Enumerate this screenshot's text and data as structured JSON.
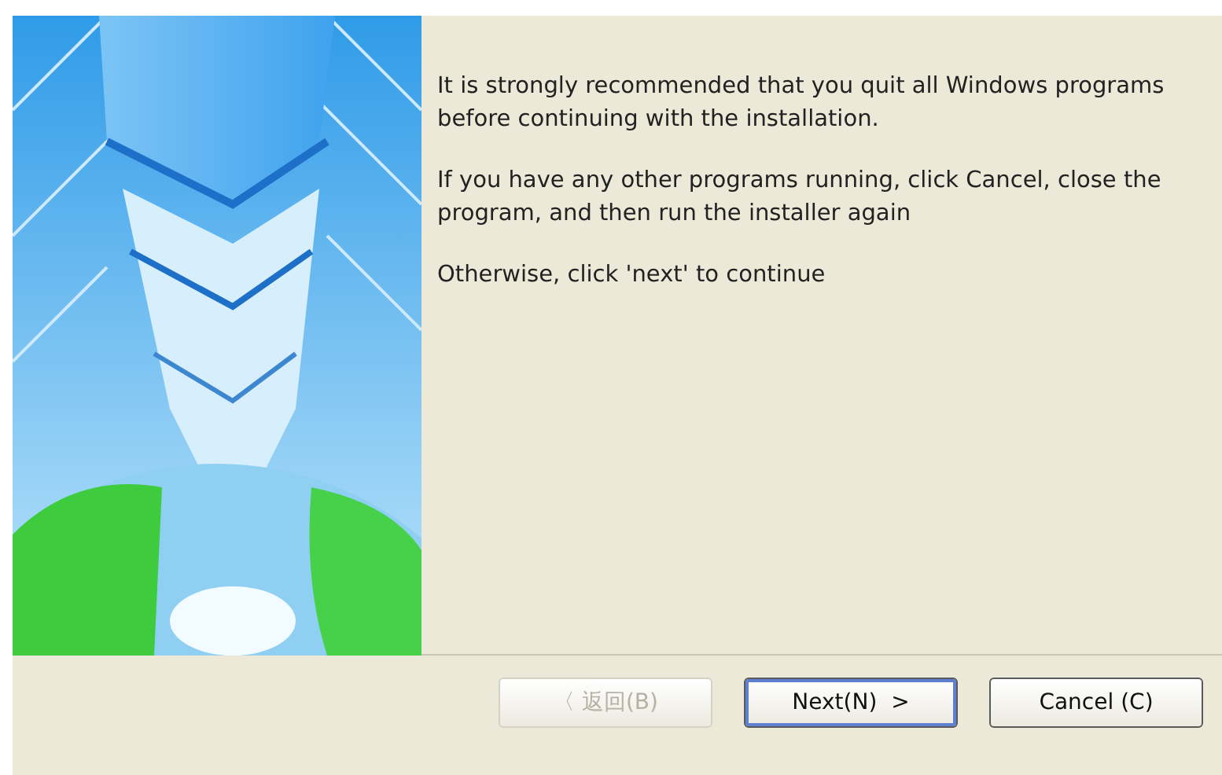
{
  "content": {
    "kind": "picture",
    "paragraphs": [
      "It is strongly recommended that you quit all Windows programs before continuing with the installation.",
      "If you have any other programs running, click Cancel, close the program, and then run the installer again",
      "Otherwise, click 'next' to continue"
    ]
  },
  "buttons": [
    {
      "label": "〈 返回(B)",
      "disabled": true,
      "default": false
    },
    {
      "label": "Next(N)  >",
      "disabled": false,
      "default": true
    },
    {
      "label": "Cancel (C)",
      "disabled": false,
      "default": false
    }
  ]
}
